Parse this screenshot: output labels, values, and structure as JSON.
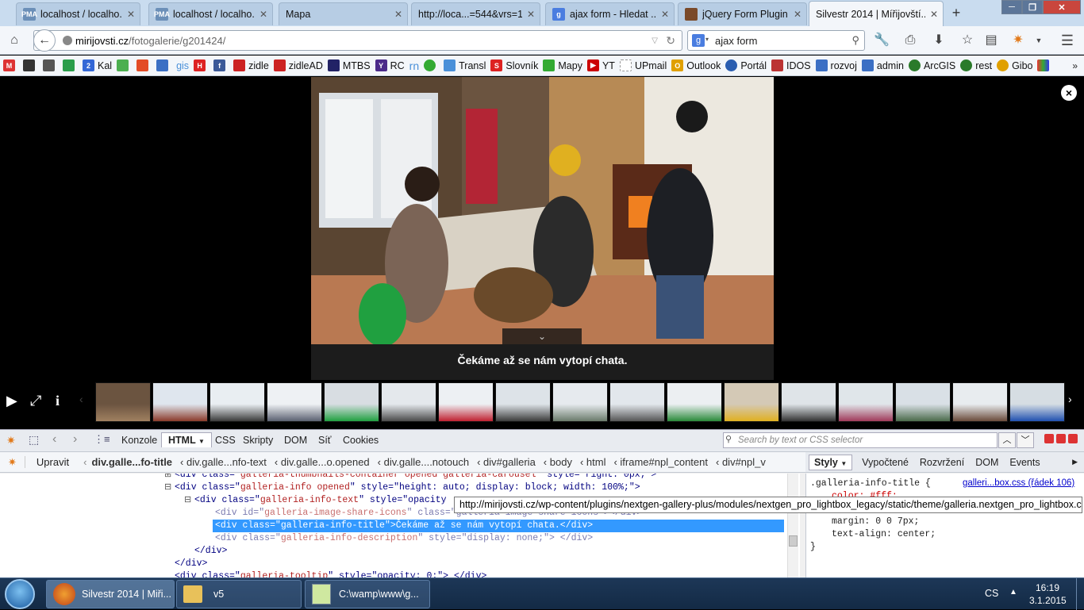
{
  "browser": {
    "tabs": [
      {
        "label": "localhost / localho...",
        "icon": "phpmyadmin-icon"
      },
      {
        "label": "localhost / localho...",
        "icon": "phpmyadmin-icon"
      },
      {
        "label": "Mapa",
        "icon": "blank-page-icon"
      },
      {
        "label": "http://loca...=544&vrs=1",
        "icon": "blank-page-icon"
      },
      {
        "label": "ajax form - Hledat ...",
        "icon": "google-icon"
      },
      {
        "label": "jQuery Form Plugin",
        "icon": "jquery-icon"
      },
      {
        "label": "Silvestr 2014 | Mířijovští...",
        "icon": "site-icon",
        "active": true
      }
    ],
    "url_host": "mirijovsti.cz",
    "url_path": "/fotogalerie/g201424/",
    "search_value": "ajax form",
    "bookmarks": [
      "",
      "",
      "",
      "",
      "Kal",
      "",
      "",
      "",
      "gis",
      "",
      "",
      "zidle",
      "zidleAD",
      "MTBS",
      "RC",
      "rn",
      "",
      "Transl",
      "Slovník",
      "Mapy",
      "YT",
      "UPmail",
      "Outlook",
      "Portál",
      "IDOS",
      "rozvoj",
      "admin",
      "ArcGIS",
      "rest",
      "Gibo",
      ""
    ]
  },
  "gallery": {
    "caption": "Čekáme až se nám vytopí chata.",
    "close_label": "×",
    "toggle_label": "⌄",
    "thumb_count": 17
  },
  "devtools": {
    "tabs": [
      "Konzole",
      "HTML",
      "CSS",
      "Skripty",
      "DOM",
      "Síť",
      "Cookies"
    ],
    "search_placeholder": "Search by text or CSS selector",
    "edit_label": "Upravit",
    "crumbs": [
      "div.galle...fo-title",
      "div.galle...nfo-text",
      "div.galle...o.opened",
      "div.galle....notouch",
      "div#galleria",
      "body",
      "html",
      "iframe#npl_content",
      "div#npl_v"
    ],
    "side_tabs": [
      "Styly",
      "Vypočtené",
      "Rozvržení",
      "DOM",
      "Events"
    ],
    "html_lines": [
      {
        "indent": 0,
        "tag_open": "<div class=\"",
        "cls": "galleria-thumbnails-container opened galleria-carousel",
        "rest": "\" style=\"right: 0px;\">"
      },
      {
        "indent": 0,
        "tag_open": "<div class=\"",
        "cls": "galleria-info opened",
        "rest": "\" style=\"height: auto; display: block; width: 100%;\">"
      },
      {
        "indent": 1,
        "tag_open": "<div class=\"",
        "cls": "galleria-info-text",
        "rest": "\" style=\"opacity"
      },
      {
        "indent": 2,
        "tag_open": "<div id=\"",
        "cls": "galleria-image-share-icons",
        "rest": "\" class=\"galleria-image-share-icons\"></div>"
      },
      {
        "indent": 2,
        "tag_open": "<div class=\"",
        "cls": "galleria-info-title",
        "rest": "\">Čekáme až se nám vytopí chata.</div>",
        "selected": true
      },
      {
        "indent": 2,
        "tag_open": "<div class=\"",
        "cls": "galleria-info-description",
        "rest": "\" style=\"display: none;\"> </div>"
      },
      {
        "indent": 1,
        "tag_open": "</div>",
        "cls": "",
        "rest": ""
      },
      {
        "indent": 0,
        "tag_open": "</div>",
        "cls": "",
        "rest": ""
      },
      {
        "indent": 0,
        "tag_open": "<div class=\"",
        "cls": "galleria-tooltip",
        "rest": "\" style=\"opacity: 0;\"> </div>"
      }
    ],
    "css_rule": {
      "selector": ".galleria-info-title {",
      "source": "galleri...box.css (řádek 106)",
      "props": [
        "color: #fff;",
        "margin: 0 0 7px;",
        "text-align: center;"
      ],
      "close": "}"
    },
    "tooltip": "http://mirijovsti.cz/wp-content/plugins/nextgen-gallery-plus/modules/nextgen_pro_lightbox_legacy/static/theme/galleria.nextgen_pro_lightbox.css"
  },
  "taskbar": {
    "items": [
      "Silvestr 2014 | Miři...",
      "v5",
      "C:\\wamp\\www\\g..."
    ],
    "lang": "CS",
    "time": "16:19",
    "date": "3.1.2015"
  }
}
